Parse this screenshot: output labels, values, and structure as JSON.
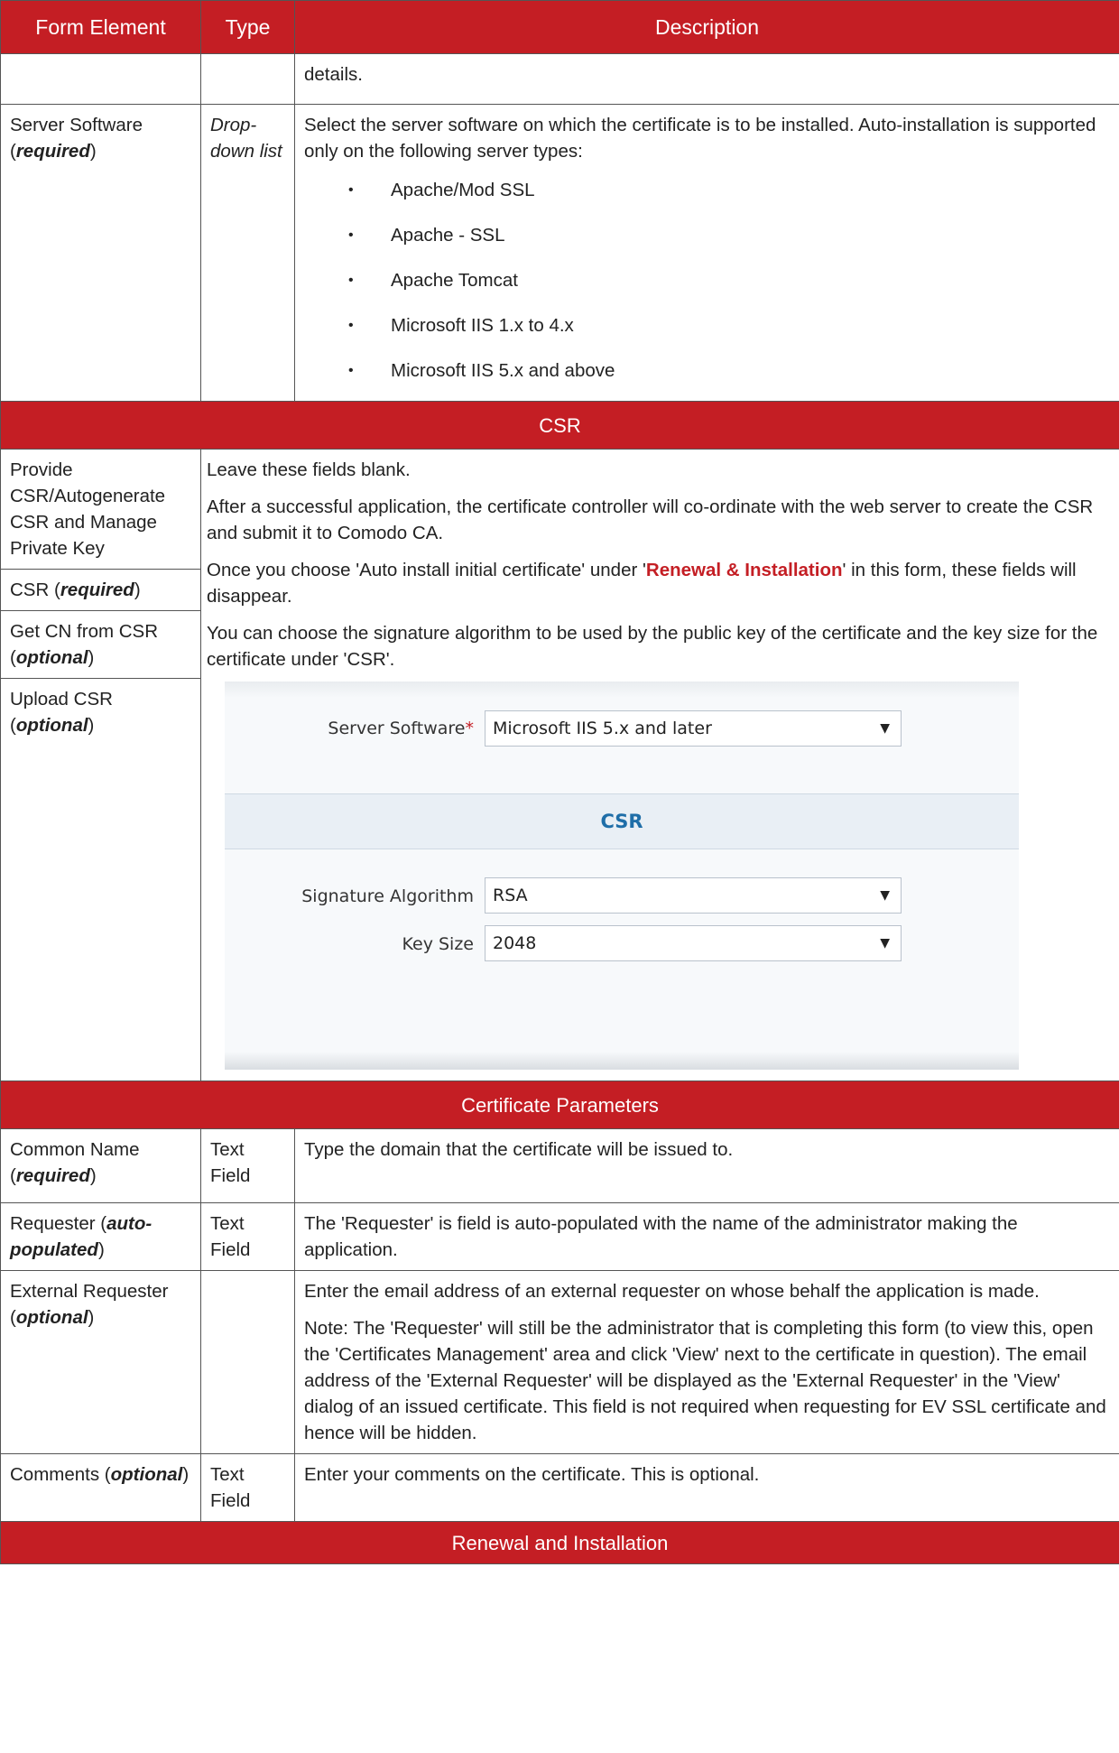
{
  "header": {
    "col1": "Form Element",
    "col2": "Type",
    "col3": "Description"
  },
  "row_details": {
    "desc": "details."
  },
  "server_software": {
    "name": "Server Software",
    "qualifier": "required",
    "type": "Drop-down list",
    "type_line1": "Drop-",
    "type_line2": "down list",
    "desc": "Select the server software on which the certificate is to be installed. Auto-installation is supported only on the following server types:",
    "items": [
      "Apache/Mod SSL",
      "Apache - SSL",
      "Apache Tomcat",
      "Microsoft IIS 1.x to 4.x",
      "Microsoft IIS 5.x and above"
    ]
  },
  "csr_section": {
    "title": "CSR",
    "fields": [
      {
        "name": "Provide CSR/Autogenerate CSR and Manage Private Key"
      },
      {
        "name": "CSR (",
        "qualifier": "required",
        "close": ")"
      },
      {
        "name": "Get CN from CSR (",
        "qualifier": "optional",
        "close": ")"
      },
      {
        "name": "Upload CSR (",
        "qualifier": "optional",
        "close": ")"
      }
    ],
    "p1": "Leave these fields blank.",
    "p2": "After a successful application, the certificate controller will co-ordinate with the web server to create the CSR and submit it to Comodo CA.",
    "p3_pre": "Once you choose 'Auto install initial certificate' under '",
    "p3_link": "Renewal & Installation",
    "p3_post": "' in this form, these fields will disappear.",
    "p4": "You can choose the signature algorithm to be used by the public key of the certificate and the key size for the certificate under 'CSR'.",
    "screenshot": {
      "server_label": "Server Software",
      "asterisk": "*",
      "server_value": "Microsoft IIS 5.x and later",
      "band_title": "CSR",
      "sig_label": "Signature Algorithm",
      "sig_value": "RSA",
      "key_label": "Key Size",
      "key_value": "2048",
      "arrow": "▼"
    }
  },
  "cert_params": {
    "title": "Certificate Parameters",
    "rows": [
      {
        "name": "Common Name (",
        "qualifier": "required",
        "close": ")",
        "type": "Text Field",
        "desc": "Type the domain that the certificate will be issued to."
      },
      {
        "name": "Requester (",
        "qualifier": "auto-populated",
        "close": ")",
        "type": "Text Field",
        "desc": "The 'Requester' is field is auto-populated with the name of the administrator making the application."
      },
      {
        "name": "External Requester (",
        "qualifier": "optional",
        "close": ")",
        "type": "",
        "desc": "Enter the email address of an external requester on whose behalf the application is made.",
        "note": "Note: The 'Requester' will still be the administrator that is completing this form (to view this, open the 'Certificates Management' area and click 'View' next to the certificate in question). The email address of the 'External Requester' will be displayed as the 'External Requester' in the 'View' dialog of an issued certificate. This field is not required when requesting for EV SSL certificate and hence will be hidden."
      },
      {
        "name": "Comments (",
        "qualifier": "optional",
        "close": ")",
        "type": "Text Field",
        "desc": "Enter your comments on the certificate. This is optional."
      }
    ]
  },
  "renewal_section": {
    "title": "Renewal and Installation"
  },
  "colors": {
    "header_red": "#c41e24",
    "link_red": "#c41e24",
    "csr_blue": "#1f6ea8"
  }
}
